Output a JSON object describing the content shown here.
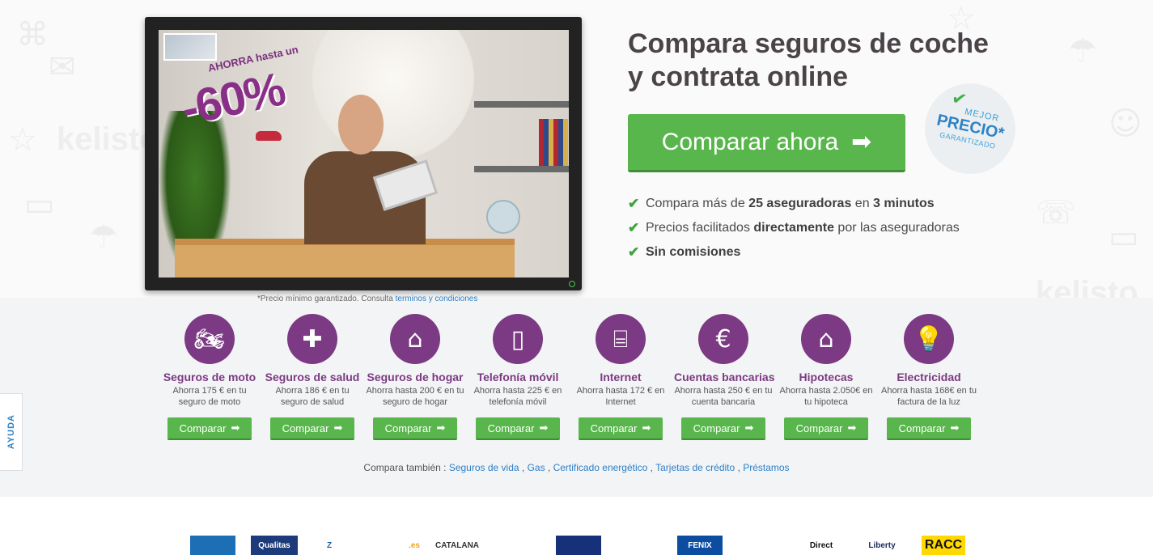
{
  "hero": {
    "headline_line1": "Compara seguros de coche",
    "headline_line2": "y contrata online",
    "cta_label": "Comparar ahora",
    "badge": {
      "mejor": "MEJOR",
      "precio": "PRECIO*",
      "garantizado": "GARANTIZADO"
    },
    "benefits": [
      {
        "pre": "Compara más de ",
        "b1": "25 aseguradoras",
        "mid": " en ",
        "b2": "3 minutos",
        "post": ""
      },
      {
        "pre": "Precios facilitados ",
        "b1": "directamente",
        "mid": " por las aseguradoras",
        "b2": "",
        "post": ""
      },
      {
        "pre": "",
        "b1": "Sin comisiones",
        "mid": "",
        "b2": "",
        "post": ""
      }
    ],
    "tv": {
      "promo_top": "AHORRA hasta un",
      "promo_big": "-60%"
    },
    "disclaimer_text": "*Precio mínimo garantizado. Consulta ",
    "disclaimer_link": "terminos y condiciones",
    "background_watermark": "kelisto"
  },
  "products": [
    {
      "icon": "motorcycle-icon",
      "glyph": "🏍",
      "title": "Seguros de moto",
      "desc": "Ahorra 175 € en tu seguro de moto",
      "button": "Comparar"
    },
    {
      "icon": "plus-icon",
      "glyph": "✚",
      "title": "Seguros de salud",
      "desc": "Ahorra 186 € en tu seguro de salud",
      "button": "Comparar"
    },
    {
      "icon": "house-icon",
      "glyph": "⌂",
      "title": "Seguros de hogar",
      "desc": "Ahorra hasta 200 € en tu seguro de hogar",
      "button": "Comparar"
    },
    {
      "icon": "mobile-phone-icon",
      "glyph": "▯",
      "title": "Telefonía móvil",
      "desc": "Ahorra hasta 225 € en telefonía móvil",
      "button": "Comparar"
    },
    {
      "icon": "router-icon",
      "glyph": "⌸",
      "title": "Internet",
      "desc": "Ahorra hasta 172 € en Internet",
      "button": "Comparar"
    },
    {
      "icon": "piggy-bank-icon",
      "glyph": "€",
      "title": "Cuentas bancarias",
      "desc": "Ahorra hasta 250 € en tu cuenta bancaria",
      "button": "Comparar"
    },
    {
      "icon": "house-euro-icon",
      "glyph": "⌂",
      "title": "Hipotecas",
      "desc": "Ahorra hasta 2.050€ en tu hipoteca",
      "button": "Comparar"
    },
    {
      "icon": "lightbulb-icon",
      "glyph": "💡",
      "title": "Electricidad",
      "desc": "Ahorra hasta 168€ en tu factura de la luz",
      "button": "Comparar"
    }
  ],
  "also": {
    "label": "Compara también : ",
    "links": [
      "Seguros de vida",
      "Gas",
      "Certificado energético",
      "Tarjetas de crédito",
      "Préstamos"
    ]
  },
  "help_tab": "AYUDA",
  "logos": [
    {
      "text": "",
      "color": "#1c6fb5",
      "bg": "#1c6fb5"
    },
    {
      "text": "Qualitas",
      "color": "#ffffff",
      "bg": "#1d3a7a"
    },
    {
      "text": "Z",
      "color": "#1c5fa8",
      "bg": "#ffffff"
    },
    {
      "text": ".es",
      "color": "#f0a020",
      "bg": "#ffffff"
    },
    {
      "text": "CATALANA",
      "color": "#333333",
      "bg": "#ffffff"
    },
    {
      "text": "",
      "color": "#f39c12",
      "bg": "#ffffff"
    },
    {
      "text": "",
      "color": "#ffffff",
      "bg": "#16307a"
    },
    {
      "text": "",
      "color": "#ffffff",
      "bg": "#ffffff"
    },
    {
      "text": "FENIX",
      "color": "#ffffff",
      "bg": "#0c4da2"
    },
    {
      "text": "",
      "color": "#3a7dc0",
      "bg": "#ffffff"
    },
    {
      "text": "Direct",
      "color": "#111111",
      "bg": "#ffffff"
    },
    {
      "text": "Liberty",
      "color": "#1a2c5a",
      "bg": "#ffffff"
    },
    {
      "text": "RACC",
      "color": "#111111",
      "bg": "#ffd800"
    }
  ],
  "colors": {
    "brand_purple": "#7b3a83",
    "cta_green": "#58b64c",
    "link_blue": "#2d7fc7"
  }
}
